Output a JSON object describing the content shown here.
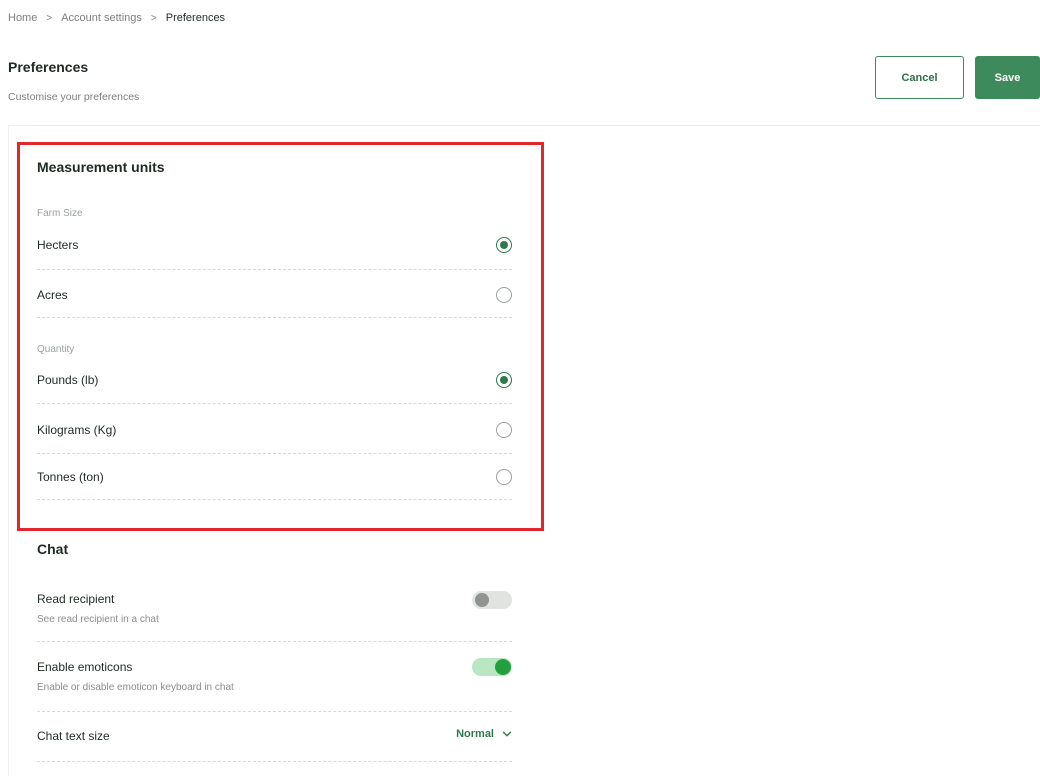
{
  "breadcrumb": {
    "items": [
      "Home",
      "Account settings",
      "Preferences"
    ]
  },
  "header": {
    "title": "Preferences",
    "subtitle": "Customise your preferences",
    "cancel_label": "Cancel",
    "save_label": "Save"
  },
  "measurement": {
    "title": "Measurement units",
    "farm_size_label": "Farm Size",
    "farm_size_options": [
      {
        "label": "Hecters",
        "selected": true
      },
      {
        "label": "Acres",
        "selected": false
      }
    ],
    "quantity_label": "Quantity",
    "quantity_options": [
      {
        "label": "Pounds (lb)",
        "selected": true
      },
      {
        "label": "Kilograms (Kg)",
        "selected": false
      },
      {
        "label": "Tonnes (ton)",
        "selected": false
      }
    ]
  },
  "chat": {
    "title": "Chat",
    "read_recipient": {
      "label": "Read recipient",
      "description": "See read recipient in a chat",
      "enabled": false
    },
    "emoticons": {
      "label": "Enable emoticons",
      "description": "Enable or disable emoticon keyboard in chat",
      "enabled": true
    },
    "text_size": {
      "label": "Chat text size",
      "value": "Normal"
    }
  },
  "colors": {
    "accent": "#3d8a5c",
    "radio_checked": "#2f7a4c",
    "toggle_on": "#23a03e",
    "highlight": "#e3262e"
  },
  "icons": {
    "breadcrumb_separator": "chevron-right-icon",
    "select_chevron": "chevron-down-icon"
  }
}
